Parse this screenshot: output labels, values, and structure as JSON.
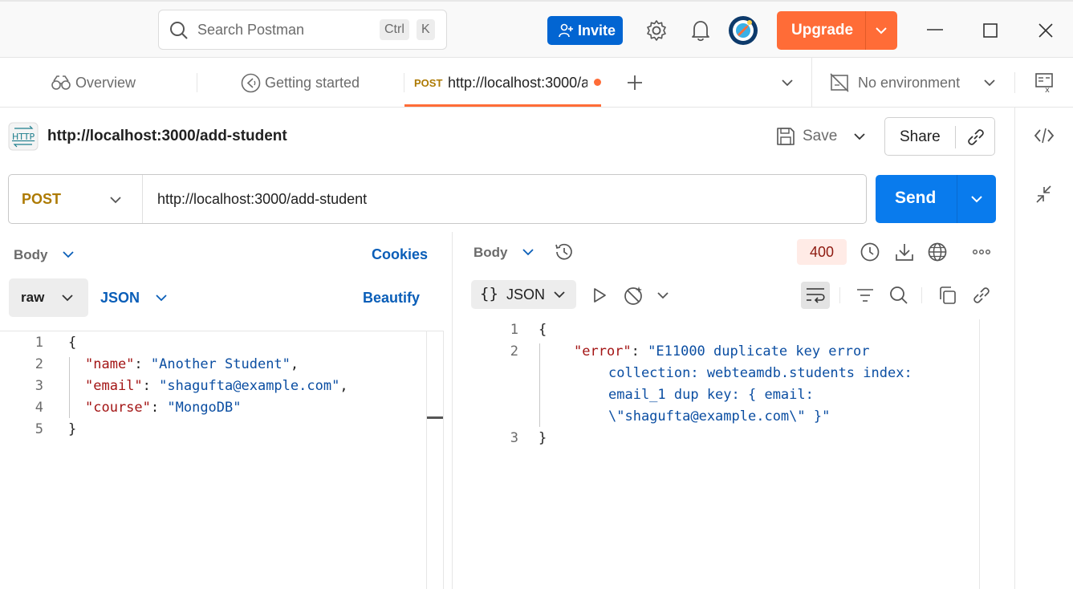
{
  "titlebar": {
    "search_placeholder": "Search Postman",
    "shortcut_ctrl": "Ctrl",
    "shortcut_k": "K",
    "invite_label": "Invite",
    "upgrade_label": "Upgrade"
  },
  "tabs": {
    "overview": "Overview",
    "getting_started": "Getting started",
    "active_method": "POST",
    "active_url": "http://localhost:3000/a",
    "environment": "No environment"
  },
  "request": {
    "title": "http://localhost:3000/add-student",
    "save_label": "Save",
    "share_label": "Share",
    "method": "POST",
    "url": "http://localhost:3000/add-student",
    "send_label": "Send",
    "body_label": "Body",
    "cookies_label": "Cookies",
    "raw_label": "raw",
    "format_label": "JSON",
    "beautify_label": "Beautify",
    "line_numbers": [
      "1",
      "2",
      "3",
      "4",
      "5"
    ],
    "body_lines": {
      "open": "{",
      "name_key": "\"name\"",
      "name_val": "\"Another Student\"",
      "email_key": "\"email\"",
      "email_val": "\"shagufta@example.com\"",
      "course_key": "\"course\"",
      "course_val": "\"MongoDB\"",
      "close": "}"
    }
  },
  "response": {
    "body_label": "Body",
    "status_code": "400",
    "format_label": "JSON",
    "line_numbers": [
      "1",
      "2",
      "3"
    ],
    "lines": {
      "open": "{",
      "error_key": "\"error\"",
      "error_val_1": "\"E11000 duplicate key error",
      "error_val_2": "collection: webteamdb.students index:",
      "error_val_3": "email_1 dup key: { email:",
      "error_val_4": "\\\"shagufta@example.com\\\" }\"",
      "close": "}"
    }
  },
  "colors": {
    "invite_blue": "#0265d2",
    "upgrade_orange": "#ff6c37",
    "send_blue": "#097bed",
    "method_post": "#ad7a03",
    "status_error_bg": "#ffebe6"
  }
}
